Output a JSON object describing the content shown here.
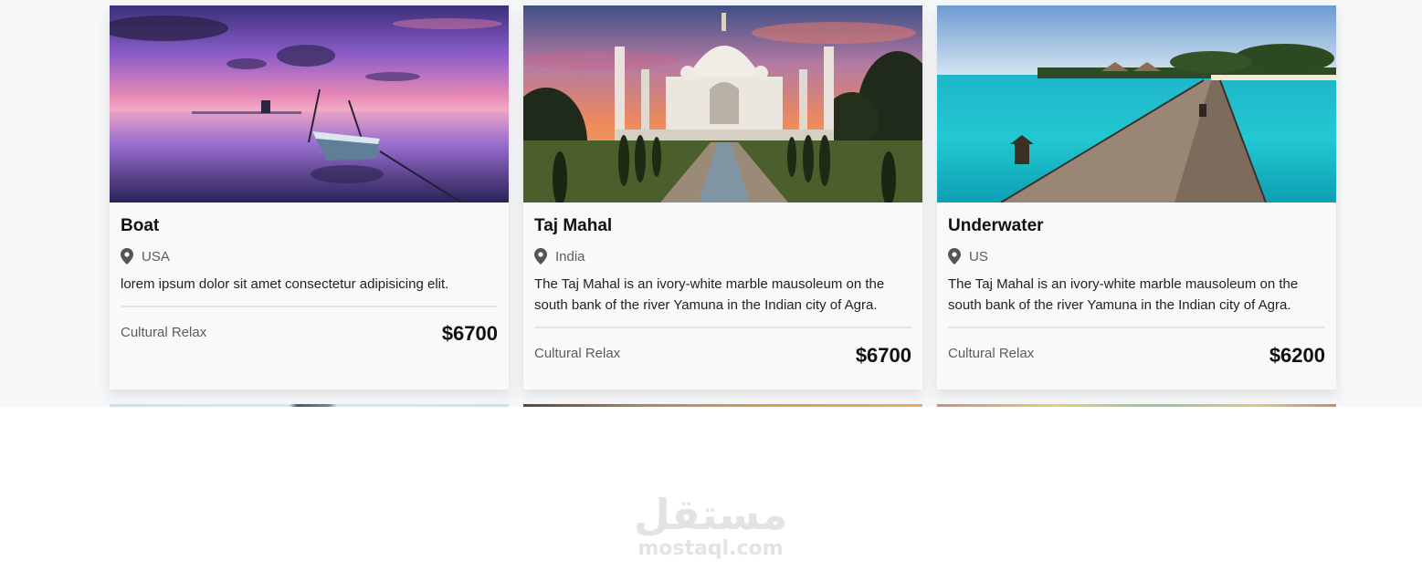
{
  "cards": [
    {
      "title": "Boat",
      "location": "USA",
      "description": "lorem ipsum dolor sit amet consectetur adipisicing elit.",
      "tags": "Cultural Relax",
      "price": "$6700",
      "icon": "map-marker-icon"
    },
    {
      "title": "Taj Mahal",
      "location": "India",
      "description": "The Taj Mahal is an ivory-white marble mausoleum on the south bank of the river Yamuna in the Indian city of Agra.",
      "tags": "Cultural Relax",
      "price": "$6700",
      "icon": "map-marker-icon"
    },
    {
      "title": "Underwater",
      "location": "US",
      "description": "The Taj Mahal is an ivory-white marble mausoleum on the south bank of the river Yamuna in the Indian city of Agra.",
      "tags": "Cultural Relax",
      "price": "$6200",
      "icon": "map-marker-icon"
    }
  ],
  "watermark": {
    "arabic": "مستقل",
    "domain": "mostaql.com"
  },
  "colors": {
    "section_bg": "#f6f7f9",
    "card_bg": "#f8f9fa",
    "text": "#111111",
    "muted": "#5c5c5c"
  }
}
